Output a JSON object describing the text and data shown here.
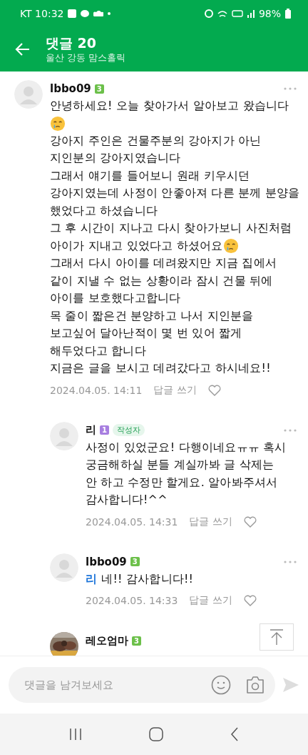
{
  "status_bar": {
    "carrier_time": "KT 10:32",
    "battery": "98%"
  },
  "header": {
    "title": "댓글 20",
    "subtitle": "울산 강동 맘스홀릭"
  },
  "comments": [
    {
      "author": "lbbo09",
      "level": "3",
      "color": "#6cc04a",
      "reply": false,
      "lines": [
        {
          "text": "안녕하세요! 오늘 찾아가서 알아보고 왔습니다"
        },
        {
          "emoji": true
        },
        {
          "text": "강아지 주인은 건물주분의 강아지가 아닌"
        },
        {
          "text": "지인분의 강아지였습니다"
        },
        {
          "text": "그래서 얘기를 들어보니 원래 키우시던"
        },
        {
          "text": "강아지였는데 사정이 안좋아져 다른 분께 분양을"
        },
        {
          "text": "했었다고 하셨습니다"
        },
        {
          "text": "그 후 시간이 지나고 다시 찾아가보니 사진처럼"
        },
        {
          "text": "아이가 지내고 있었다고 하셨어요",
          "emoji": true
        },
        {
          "text": "그래서 다시 아이를 데려왔지만 지금 집에서"
        },
        {
          "text": "같이 지낼 수 없는 상황이라 잠시 건물 뒤에"
        },
        {
          "text": "아이를 보호했다고합니다"
        },
        {
          "text": "목 줄이 짧은건 분양하고 나서 지인분을"
        },
        {
          "text": "보고싶어 달아난적이 몇 번 있어 짧게"
        },
        {
          "text": "해두었다고 합니다"
        },
        {
          "text": "지금은 글을 보시고 데려갔다고 하시네요!!"
        }
      ],
      "date": "2024.04.05. 14:11",
      "reply_label": "답글 쓰기"
    },
    {
      "author": "리",
      "level": "1",
      "color": "#a77ee0",
      "badge": "작성자",
      "reply": true,
      "lines": [
        {
          "text": "사정이 있었군요! 다행이네요ㅠㅠ 혹시"
        },
        {
          "text": "궁금해하실 분들 계실까봐 글 삭제는"
        },
        {
          "text": "안 하고 수정만 할게요. 알아봐주셔서"
        },
        {
          "text": "감사합니다!^^"
        }
      ],
      "date": "2024.04.05. 14:31",
      "reply_label": "답글 쓰기"
    },
    {
      "author": "lbbo09",
      "level": "3",
      "color": "#6cc04a",
      "reply": true,
      "lines": [
        {
          "mention": "리",
          "text": "네!! 감사합니다!!"
        }
      ],
      "date": "2024.04.05. 14:33",
      "reply_label": "답글 쓰기"
    },
    {
      "author": "레오엄마",
      "level": "3",
      "color": "#6cc04a",
      "reply": true
    }
  ],
  "composer": {
    "placeholder": "댓글을 남겨보세요"
  }
}
